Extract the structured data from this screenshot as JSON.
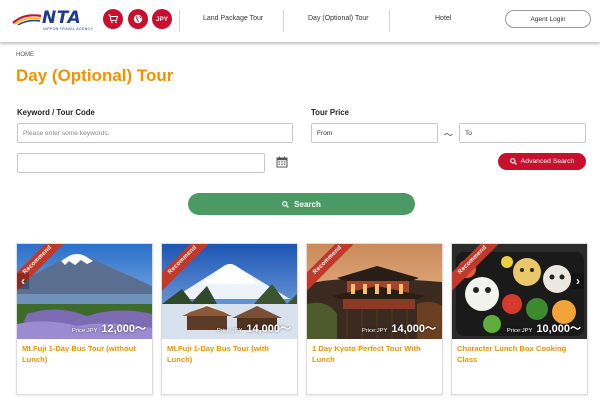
{
  "header": {
    "logo_text": "NTA",
    "logo_subtext": "NIPPON TRAVEL AGENCY",
    "currency": "JPY",
    "nav": [
      "Land Package Tour",
      "Day (Optional) Tour",
      "Hotel"
    ],
    "agent_login": "Agent Login",
    "icons": [
      "cart-icon",
      "globe-icon"
    ]
  },
  "breadcrumb": "HOME",
  "page_title": "Day (Optional) Tour",
  "search": {
    "keyword_label": "Keyword / Tour Code",
    "keyword_placeholder": "Please enter some keywords.",
    "price_label": "Tour Price",
    "price_from": "From",
    "price_tilde": "～",
    "price_to": "To",
    "date_value": "",
    "advanced_label": "Advanced Search",
    "search_label": "Search"
  },
  "colors": {
    "brand_red": "#c8102e",
    "accent_orange": "#f39200",
    "search_green": "#4c9a63"
  },
  "cards": [
    {
      "badge": "Recommend",
      "price_label": "Price:JPY",
      "price": "12,000～",
      "title": "Mt.Fuji 1-Day Bus Tour (without Lunch)"
    },
    {
      "badge": "Recommend",
      "price_label": "Price:JPY",
      "price": "14,000～",
      "title": "Mt.Fuji 1-Day Bus Tour (with Lunch)"
    },
    {
      "badge": "Recommend",
      "price_label": "Price:JPY",
      "price": "14,000～",
      "title": "1 Day Kyoto Perfect Tour With Lunch"
    },
    {
      "badge": "Recommend",
      "price_label": "Price:JPY",
      "price": "10,000～",
      "title": "Character Lunch Box Cooking Class"
    }
  ],
  "carousel": {
    "prev": "‹",
    "next": "›"
  }
}
